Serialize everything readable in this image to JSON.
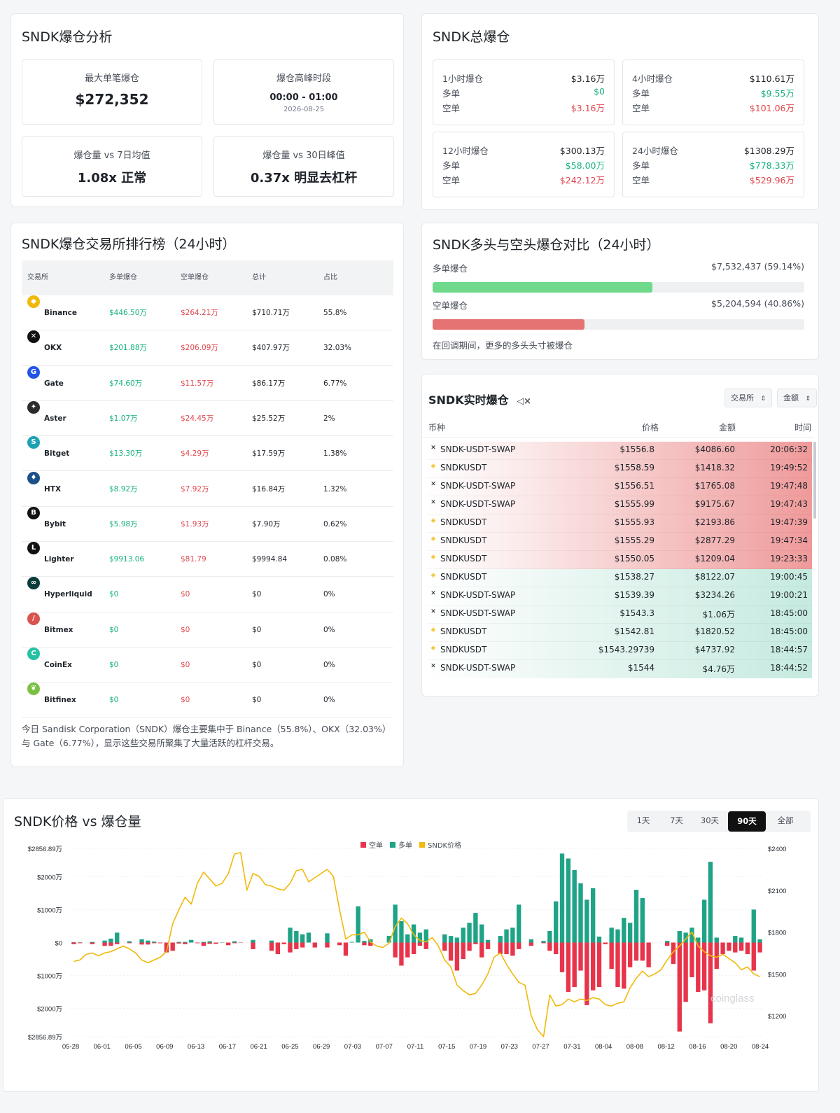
{
  "summary": {
    "title": "SNDK爆仓分析",
    "max_single": {
      "label": "最大单笔爆仓",
      "value": "$272,352"
    },
    "peak_time": {
      "label": "爆仓高峰时段",
      "value": "00:00 - 01:00",
      "date": "2026-08-25"
    },
    "vs7d": {
      "label": "爆仓量 vs 7日均值",
      "value": "1.08x 正常"
    },
    "vs30d": {
      "label": "爆仓量 vs 30日峰值",
      "value": "0.37x 明显去杠杆"
    }
  },
  "totals": {
    "title": "SNDK总爆仓",
    "long_label": "多单",
    "short_label": "空单",
    "boxes": [
      {
        "label": "1小时爆仓",
        "total": "$3.16万",
        "long": "$0",
        "short": "$3.16万"
      },
      {
        "label": "4小时爆仓",
        "total": "$110.61万",
        "long": "$9.55万",
        "short": "$101.06万"
      },
      {
        "label": "12小时爆仓",
        "total": "$300.13万",
        "long": "$58.00万",
        "short": "$242.12万"
      },
      {
        "label": "24小时爆仓",
        "total": "$1308.29万",
        "long": "$778.33万",
        "short": "$529.96万"
      }
    ]
  },
  "exchanges": {
    "title": "SNDK爆仓交易所排行榜（24小时）",
    "headers": [
      "交易所",
      "多单爆仓",
      "空单爆仓",
      "总计",
      "占比"
    ],
    "rows": [
      {
        "name": "Binance",
        "long": "$446.50万",
        "short": "$264.21万",
        "total": "$710.71万",
        "pct": "55.8%"
      },
      {
        "name": "OKX",
        "long": "$201.88万",
        "short": "$206.09万",
        "total": "$407.97万",
        "pct": "32.03%"
      },
      {
        "name": "Gate",
        "long": "$74.60万",
        "short": "$11.57万",
        "total": "$86.17万",
        "pct": "6.77%"
      },
      {
        "name": "Aster",
        "long": "$1.07万",
        "short": "$24.45万",
        "total": "$25.52万",
        "pct": "2%"
      },
      {
        "name": "Bitget",
        "long": "$13.30万",
        "short": "$4.29万",
        "total": "$17.59万",
        "pct": "1.38%"
      },
      {
        "name": "HTX",
        "long": "$8.92万",
        "short": "$7.92万",
        "total": "$16.84万",
        "pct": "1.32%"
      },
      {
        "name": "Bybit",
        "long": "$5.98万",
        "short": "$1.93万",
        "total": "$7.90万",
        "pct": "0.62%"
      },
      {
        "name": "Lighter",
        "long": "$9913.06",
        "short": "$81.79",
        "total": "$9994.84",
        "pct": "0.08%"
      },
      {
        "name": "Hyperliquid",
        "long": "$0",
        "short": "$0",
        "total": "$0",
        "pct": "0%"
      },
      {
        "name": "Bitmex",
        "long": "$0",
        "short": "$0",
        "total": "$0",
        "pct": "0%"
      },
      {
        "name": "CoinEx",
        "long": "$0",
        "short": "$0",
        "total": "$0",
        "pct": "0%"
      },
      {
        "name": "Bitfinex",
        "long": "$0",
        "short": "$0",
        "total": "$0",
        "pct": "0%"
      }
    ],
    "note": "今日 Sandisk Corporation（SNDK）爆仓主要集中于 Binance（55.8%）、OKX（32.03%）与 Gate（6.77%），显示这些交易所聚集了大量活跃的杠杆交易。"
  },
  "long_short": {
    "title": "SNDK多头与空头爆仓对比（24小时）",
    "long_label": "多单爆仓",
    "long_value": "$7,532,437 (59.14%)",
    "long_pct": 59.14,
    "short_label": "空单爆仓",
    "short_value": "$5,204,594 (40.86%)",
    "short_pct": 40.86,
    "note": "在回调期间，更多的多头头寸被爆仓",
    "colors": {
      "long": "#6fd98b",
      "short": "#e57373"
    }
  },
  "realtime": {
    "title": "SNDK实时爆仓",
    "filter_exchange": "交易所",
    "filter_amount": "金额",
    "headers": [
      "币种",
      "价格",
      "金额",
      "时间"
    ],
    "rows": [
      {
        "ex": "okx",
        "pair": "SNDK-USDT-SWAP",
        "price": "$1556.8",
        "amount": "$4086.60",
        "time": "20:06:32",
        "side": "short"
      },
      {
        "ex": "binance",
        "pair": "SNDKUSDT",
        "price": "$1558.59",
        "amount": "$1418.32",
        "time": "19:49:52",
        "side": "short"
      },
      {
        "ex": "okx",
        "pair": "SNDK-USDT-SWAP",
        "price": "$1556.51",
        "amount": "$1765.08",
        "time": "19:47:48",
        "side": "short"
      },
      {
        "ex": "okx",
        "pair": "SNDK-USDT-SWAP",
        "price": "$1555.99",
        "amount": "$9175.67",
        "time": "19:47:43",
        "side": "short"
      },
      {
        "ex": "binance",
        "pair": "SNDKUSDT",
        "price": "$1555.93",
        "amount": "$2193.86",
        "time": "19:47:39",
        "side": "short"
      },
      {
        "ex": "binance",
        "pair": "SNDKUSDT",
        "price": "$1555.29",
        "amount": "$2877.29",
        "time": "19:47:34",
        "side": "short"
      },
      {
        "ex": "binance",
        "pair": "SNDKUSDT",
        "price": "$1550.05",
        "amount": "$1209.04",
        "time": "19:23:33",
        "side": "short"
      },
      {
        "ex": "binance",
        "pair": "SNDKUSDT",
        "price": "$1538.27",
        "amount": "$8122.07",
        "time": "19:00:45",
        "side": "long"
      },
      {
        "ex": "okx",
        "pair": "SNDK-USDT-SWAP",
        "price": "$1539.39",
        "amount": "$3234.26",
        "time": "19:00:21",
        "side": "long"
      },
      {
        "ex": "okx",
        "pair": "SNDK-USDT-SWAP",
        "price": "$1543.3",
        "amount": "$1.06万",
        "time": "18:45:00",
        "side": "long"
      },
      {
        "ex": "binance",
        "pair": "SNDKUSDT",
        "price": "$1542.81",
        "amount": "$1820.52",
        "time": "18:45:00",
        "side": "long"
      },
      {
        "ex": "binance",
        "pair": "SNDKUSDT",
        "price": "$1543.29739",
        "amount": "$4737.92",
        "time": "18:44:57",
        "side": "long"
      },
      {
        "ex": "okx",
        "pair": "SNDK-USDT-SWAP",
        "price": "$1544",
        "amount": "$4.76万",
        "time": "18:44:52",
        "side": "long"
      }
    ]
  },
  "chart": {
    "title": "SNDK价格 vs 爆仓量",
    "ranges": [
      "1天",
      "7天",
      "30天",
      "90天",
      "全部"
    ],
    "active_range": "90天",
    "legend": [
      "空单",
      "多单",
      "SNDK价格"
    ],
    "watermark": "coinglass",
    "colors": {
      "short": "#e8344b",
      "long": "#1fa386",
      "price": "#f0b90b"
    }
  },
  "chart_data": {
    "type": "bar",
    "title": "SNDK价格 vs 爆仓量",
    "y_left_ticks": [
      "$2856.89万",
      "$2000万",
      "$1000万",
      "$0",
      "$1000万",
      "$2000万",
      "$2856.89万"
    ],
    "y_left_range": [
      -2856.89,
      2856.89
    ],
    "y_right_ticks": [
      "$2400",
      "$2100",
      "$1800",
      "$1500",
      "$1200"
    ],
    "y_right_range": [
      1050,
      2400
    ],
    "x_ticks": [
      "05-28",
      "06-01",
      "06-05",
      "06-09",
      "06-13",
      "06-17",
      "06-21",
      "06-25",
      "06-29",
      "07-03",
      "07-07",
      "07-11",
      "07-15",
      "07-19",
      "07-23",
      "07-27",
      "07-31",
      "08-04",
      "08-08",
      "08-12",
      "08-16",
      "08-20",
      "08-24"
    ],
    "series": [
      {
        "name": "多单",
        "values": [
          10,
          5,
          0,
          20,
          0,
          60,
          120,
          300,
          0,
          40,
          0,
          100,
          60,
          30,
          0,
          0,
          0,
          20,
          20,
          80,
          0,
          20,
          40,
          0,
          10,
          0,
          40,
          0,
          0,
          80,
          0,
          0,
          60,
          0,
          0,
          450,
          350,
          250,
          300,
          0,
          0,
          280,
          0,
          0,
          0,
          20,
          1100,
          50,
          100,
          0,
          0,
          200,
          1150,
          650,
          250,
          550,
          300,
          400,
          0,
          0,
          250,
          200,
          150,
          450,
          600,
          900,
          550,
          80,
          0,
          200,
          400,
          450,
          1150,
          0,
          100,
          0,
          50,
          350,
          1250,
          2700,
          2550,
          2200,
          1800,
          1300,
          1650,
          180,
          0,
          450,
          400,
          750,
          600,
          1600,
          1350,
          0,
          0,
          0,
          50,
          0,
          350,
          300,
          450,
          150,
          1300,
          2450,
          150,
          0,
          0,
          200,
          150,
          0,
          1000,
          100
        ]
      },
      {
        "name": "空单",
        "values": [
          -50,
          -20,
          0,
          -50,
          0,
          -100,
          -100,
          -50,
          0,
          -20,
          0,
          -60,
          -60,
          -20,
          -20,
          -300,
          -250,
          -30,
          -50,
          0,
          -20,
          -100,
          -40,
          -40,
          0,
          -80,
          -20,
          -10,
          0,
          -200,
          0,
          0,
          -250,
          -350,
          -50,
          -300,
          -200,
          -150,
          0,
          -150,
          0,
          -150,
          0,
          -80,
          -400,
          0,
          0,
          -80,
          -100,
          0,
          0,
          0,
          -450,
          -700,
          -450,
          -350,
          -100,
          -200,
          0,
          0,
          -250,
          -550,
          -850,
          -500,
          -250,
          -50,
          -450,
          -200,
          0,
          -350,
          -350,
          -400,
          -200,
          0,
          -100,
          0,
          -20,
          -250,
          -350,
          -900,
          -1500,
          -1350,
          -850,
          -1900,
          -1450,
          -1350,
          -50,
          -800,
          -1350,
          -1400,
          -750,
          -550,
          -550,
          -750,
          0,
          0,
          -100,
          -650,
          -2700,
          -1800,
          -1050,
          -1500,
          -1450,
          -2450,
          -800,
          -350,
          -250,
          -300,
          -250,
          -350,
          -850,
          -300,
          -250
        ]
      },
      {
        "name": "SNDK价格",
        "values": [
          1590,
          1600,
          1640,
          1650,
          1630,
          1650,
          1660,
          1680,
          1700,
          1680,
          1650,
          1600,
          1580,
          1600,
          1620,
          1660,
          1860,
          1960,
          2050,
          2000,
          2150,
          2230,
          2180,
          2130,
          2150,
          2220,
          2360,
          2370,
          2100,
          2220,
          2200,
          2140,
          2130,
          2110,
          2100,
          2150,
          2240,
          2250,
          2160,
          2190,
          2220,
          2250,
          2200,
          1960,
          1750,
          1780,
          1780,
          1800,
          1730,
          1700,
          1690,
          1720,
          1840,
          1900,
          1860,
          1780,
          1740,
          1730,
          1760,
          1700,
          1600,
          1550,
          1420,
          1380,
          1350,
          1360,
          1420,
          1500,
          1620,
          1650,
          1570,
          1500,
          1440,
          1420,
          1200,
          1100,
          1050,
          1350,
          1270,
          1280,
          1320,
          1300,
          1320,
          1310,
          1330,
          1320,
          1280,
          1270,
          1290,
          1300,
          1400,
          1470,
          1520,
          1480,
          1500,
          1530,
          1600,
          1660,
          1700,
          1750,
          1800,
          1700,
          1660,
          1630,
          1620,
          1640,
          1610,
          1580,
          1530,
          1550,
          1500,
          1480
        ]
      }
    ],
    "legend_position": "top-center"
  }
}
